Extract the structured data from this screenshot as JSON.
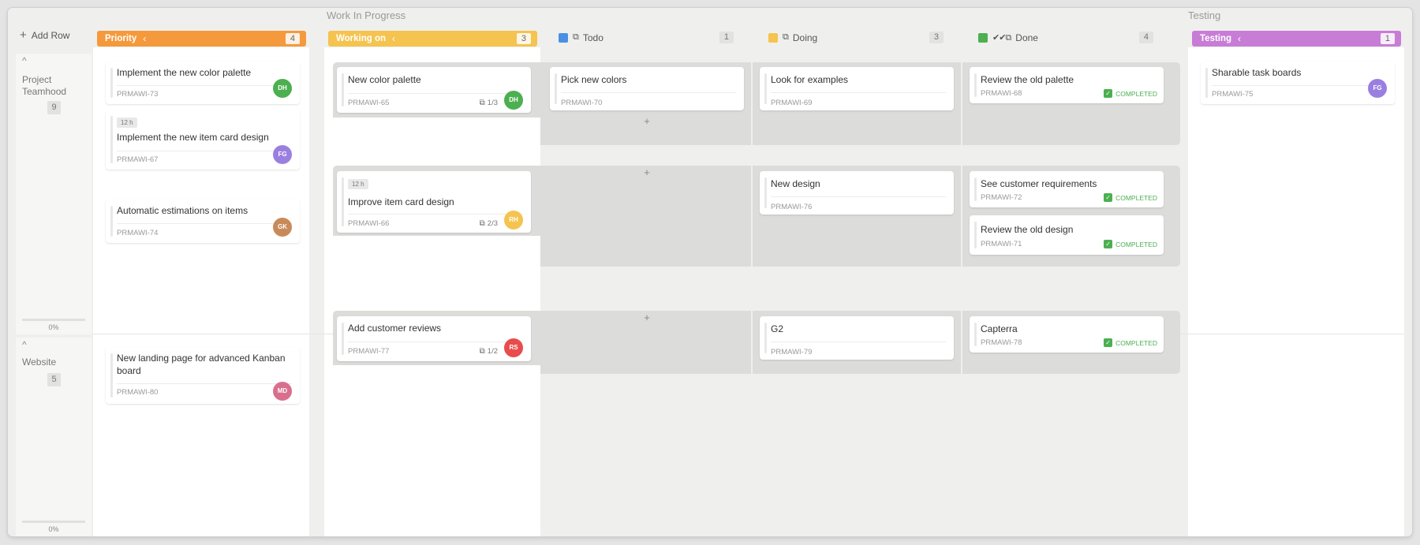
{
  "board": {
    "groups": {
      "wip": "Work In Progress",
      "testing": "Testing"
    },
    "add_row": "Add Row"
  },
  "rows": [
    {
      "title": "Project Teamhood",
      "count": "9",
      "progress": "0%"
    },
    {
      "title": "Website",
      "count": "5",
      "progress": "0%"
    }
  ],
  "columns": {
    "priority": {
      "label": "Priority",
      "count": "4",
      "color": "#f59a3c"
    },
    "working": {
      "label": "Working on",
      "count": "3",
      "color": "#f5c34f"
    },
    "todo": {
      "label": "Todo",
      "count": "1",
      "color": "#4a90e2"
    },
    "doing": {
      "label": "Doing",
      "count": "3",
      "color": "#f5c34f"
    },
    "done": {
      "label": "Done",
      "count": "4",
      "color": "#4caf50"
    },
    "testing": {
      "label": "Testing",
      "count": "1",
      "color": "#c77dd6"
    }
  },
  "cards": {
    "p1": {
      "title": "Implement the new color palette",
      "id": "PRMAWI-73",
      "avatar": "DH"
    },
    "p2": {
      "tag": "12 h",
      "title": "Implement the new item card design",
      "id": "PRMAWI-67",
      "avatar": "FG"
    },
    "p3": {
      "title": "Automatic estimations on items",
      "id": "PRMAWI-74",
      "avatar": "GK"
    },
    "p4": {
      "title": "New landing page for advanced Kanban board",
      "id": "PRMAWI-80",
      "avatar": "MD"
    },
    "w1": {
      "title": "New color palette",
      "id": "PRMAWI-65",
      "sub": "1/3",
      "avatar": "DH"
    },
    "w2": {
      "tag": "12 h",
      "title": "Improve item card design",
      "id": "PRMAWI-66",
      "sub": "2/3",
      "avatar": "RH"
    },
    "w3": {
      "title": "Add customer reviews",
      "id": "PRMAWI-77",
      "sub": "1/2",
      "avatar": "RS"
    },
    "t1": {
      "title": "Pick new colors",
      "id": "PRMAWI-70"
    },
    "d1": {
      "title": "Look for examples",
      "id": "PRMAWI-69"
    },
    "d2": {
      "title": "New design",
      "id": "PRMAWI-76"
    },
    "d3": {
      "title": "G2",
      "id": "PRMAWI-79"
    },
    "n1": {
      "title": "Review the old palette",
      "id": "PRMAWI-68",
      "status": "COMPLETED"
    },
    "n2": {
      "title": "See customer requirements",
      "id": "PRMAWI-72",
      "status": "COMPLETED"
    },
    "n3": {
      "title": "Review the old design",
      "id": "PRMAWI-71",
      "status": "COMPLETED"
    },
    "n4": {
      "title": "Capterra",
      "id": "PRMAWI-78",
      "status": "COMPLETED"
    },
    "s1": {
      "title": "Sharable task boards",
      "id": "PRMAWI-75",
      "avatar": "FG"
    }
  },
  "add_item": "+"
}
